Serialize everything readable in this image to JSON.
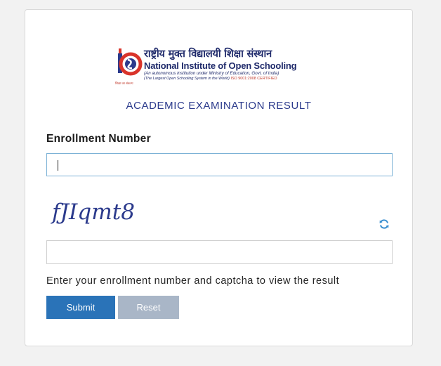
{
  "logo": {
    "hindi_name": "राष्ट्रीय मुक्त विद्यालयी शिक्षा संस्थान",
    "english_name": "National Institute of Open Schooling",
    "subtitle": "(An autonomous institution under Ministry of Education, Govt. of India)",
    "tagline": "(The Largest Open Schooling System in the World)",
    "certification": "ISO 9001:2008 CERTIFIED",
    "emblem_caption": "शिक्षा का संकल्प"
  },
  "page": {
    "title": "ACADEMIC EXAMINATION RESULT"
  },
  "form": {
    "enrollment_label": "Enrollment Number",
    "enrollment_value": "",
    "enrollment_placeholder": "",
    "captcha_text": "fJIqmt8",
    "captcha_value": "",
    "captcha_placeholder": "",
    "hint": "Enter your enrollment number and captcha to view the result",
    "submit_label": "Submit",
    "reset_label": "Reset"
  },
  "icons": {
    "refresh": "refresh-icon"
  },
  "colors": {
    "brand_blue": "#2b3a8c",
    "submit_bg": "#2a73b8",
    "reset_bg": "#a9b6c7",
    "emblem_red": "#d9342b",
    "active_border": "#7cb2d6"
  }
}
